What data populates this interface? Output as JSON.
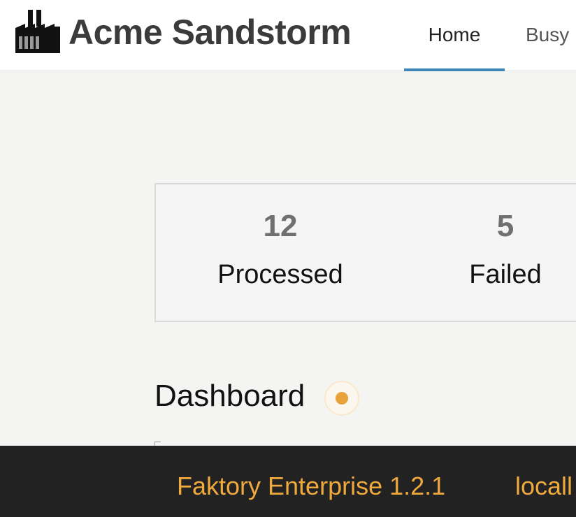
{
  "brand": {
    "name": "Acme Sandstorm",
    "icon": "factory-icon"
  },
  "nav": {
    "items": [
      {
        "label": "Home",
        "active": true
      },
      {
        "label": "Busy",
        "active": false
      }
    ]
  },
  "stats": [
    {
      "count": "12",
      "label": "Processed"
    },
    {
      "count": "5",
      "label": "Failed"
    }
  ],
  "dashboard": {
    "title": "Dashboard",
    "status_icon": "status-dot-icon",
    "status_color": "#e8a23a"
  },
  "footer": {
    "version": "Faktory Enterprise 1.2.1",
    "host": "locall"
  },
  "colors": {
    "accent": "#3d87b8",
    "footer_text": "#f0a93c",
    "footer_bg": "#222222"
  }
}
